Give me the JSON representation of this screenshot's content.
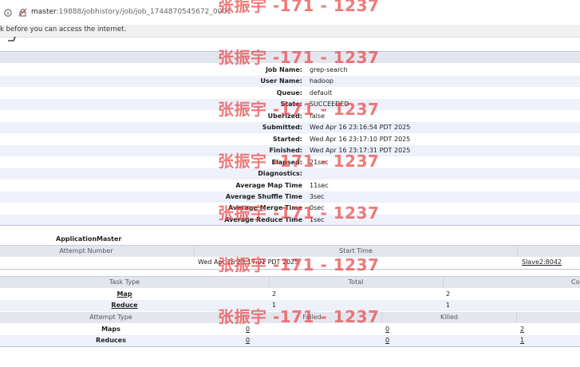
{
  "browser": {
    "url_host": "master",
    "url_rest": ":19888/jobhistory/job/job_1744870545672_0001"
  },
  "notice": {
    "text": "k before you can access the internet."
  },
  "job": {
    "fields": [
      {
        "key": "Job Name:",
        "value": "grep-search"
      },
      {
        "key": "User Name:",
        "value": "hadoop"
      },
      {
        "key": "Queue:",
        "value": "default"
      },
      {
        "key": "State:",
        "value": "SUCCEEDED"
      },
      {
        "key": "Uberized:",
        "value": "false"
      },
      {
        "key": "Submitted:",
        "value": "Wed Apr 16 23:16:54 PDT 2025"
      },
      {
        "key": "Started:",
        "value": "Wed Apr 16 23:17:10 PDT 2025"
      },
      {
        "key": "Finished:",
        "value": "Wed Apr 16 23:17:31 PDT 2025"
      },
      {
        "key": "Elapsed:",
        "value": "21sec"
      },
      {
        "key": "Diagnostics:",
        "value": ""
      },
      {
        "key": "Average Map Time",
        "value": "11sec"
      },
      {
        "key": "Average Shuffle Time",
        "value": "3sec"
      },
      {
        "key": "Average Merge Time",
        "value": "0sec"
      },
      {
        "key": "Average Reduce Time",
        "value": "1sec"
      }
    ]
  },
  "am": {
    "title": "ApplicationMaster",
    "col_attempt": "Attempt Number",
    "col_start": "Start Time",
    "start_time": "Wed Apr 16 23:17:01 PDT 2025",
    "node_link": "Slave2:8042"
  },
  "tasks": {
    "col_type": "Task Type",
    "col_total": "Total",
    "col_complete": "Co",
    "rows": [
      {
        "type": "Map",
        "total": "2",
        "complete": "2"
      },
      {
        "type": "Reduce",
        "total": "1",
        "complete": "1"
      }
    ]
  },
  "attempts": {
    "col_type": "Attempt Type",
    "col_failed": "Failed",
    "col_killed": "Killed",
    "rows": [
      {
        "type": "Maps",
        "failed": "0",
        "killed": "0",
        "successful": "2"
      },
      {
        "type": "Reduces",
        "failed": "0",
        "killed": "0",
        "successful": "1"
      }
    ]
  },
  "watermark": {
    "text": "张振宇 -171 - 1237"
  }
}
